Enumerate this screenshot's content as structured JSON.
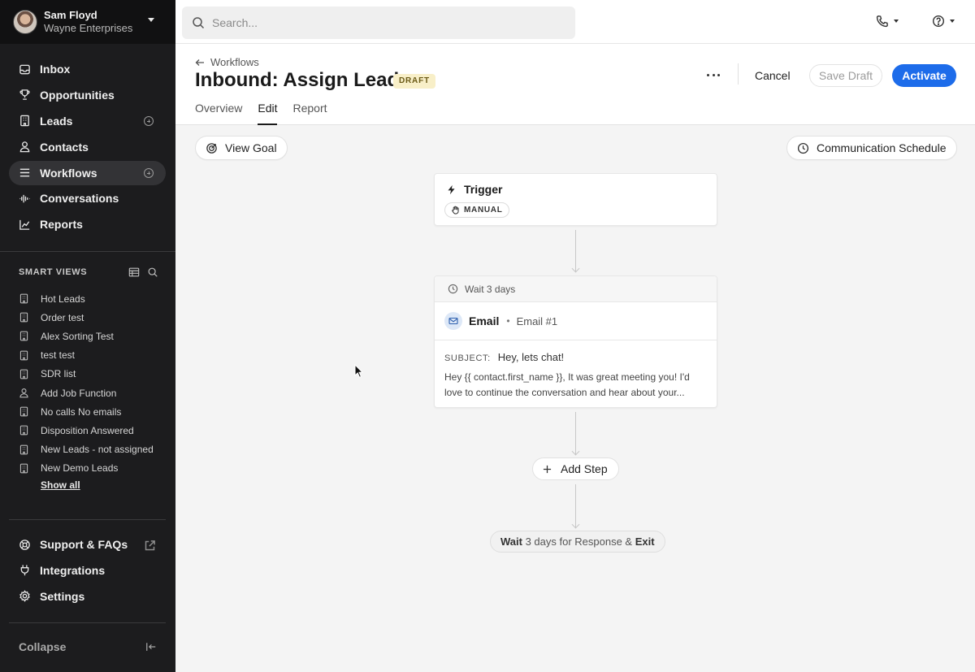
{
  "user": {
    "name": "Sam Floyd",
    "org": "Wayne Enterprises"
  },
  "nav": [
    {
      "label": "Inbox",
      "icon": "inbox-icon"
    },
    {
      "label": "Opportunities",
      "icon": "trophy-icon"
    },
    {
      "label": "Leads",
      "icon": "building-icon"
    },
    {
      "label": "Contacts",
      "icon": "person-icon"
    },
    {
      "label": "Workflows",
      "icon": "list-icon",
      "active": true
    },
    {
      "label": "Conversations",
      "icon": "waveform-icon"
    },
    {
      "label": "Reports",
      "icon": "chart-icon"
    }
  ],
  "smart_views": {
    "title": "SMART VIEWS",
    "items": [
      "Hot Leads",
      "Order test",
      "Alex Sorting Test",
      "test test",
      "SDR list",
      "Add Job Function",
      "No calls No emails",
      "Disposition Answered",
      "New Leads - not assigned",
      "New Demo Leads"
    ],
    "show_all": "Show all"
  },
  "bottom_nav": [
    {
      "label": "Support & FAQs",
      "icon": "lifebuoy-icon"
    },
    {
      "label": "Integrations",
      "icon": "plug-icon"
    },
    {
      "label": "Settings",
      "icon": "gear-icon"
    }
  ],
  "collapse_label": "Collapse",
  "search": {
    "placeholder": "Search..."
  },
  "header": {
    "back_label": "Workflows",
    "title": "Inbound: Assign Lead",
    "status_badge": "DRAFT",
    "tabs": [
      "Overview",
      "Edit",
      "Report"
    ],
    "active_tab": "Edit",
    "cancel": "Cancel",
    "save_draft": "Save Draft",
    "activate": "Activate"
  },
  "canvas": {
    "view_goal": "View Goal",
    "communication_schedule": "Communication Schedule",
    "trigger": {
      "title": "Trigger",
      "type": "MANUAL"
    },
    "step": {
      "wait": "Wait 3 days",
      "type": "Email",
      "name": "Email #1",
      "subject_label": "SUBJECT:",
      "subject": "Hey, lets chat!",
      "body": "Hey {{ contact.first_name }}, It was great meeting you! I'd love to continue the conversation and hear about your..."
    },
    "add_step": "Add Step",
    "exit": {
      "part1": "Wait",
      "part2": " 3 days for Response & ",
      "part3": "Exit"
    }
  },
  "colors": {
    "primary": "#1d6cea",
    "sidebar_bg": "#1c1c1e",
    "draft_badge_bg": "#f8efc8"
  }
}
